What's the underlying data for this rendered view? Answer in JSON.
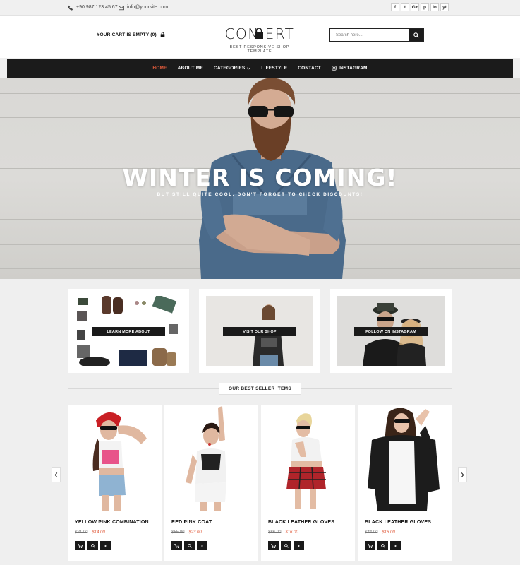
{
  "topbar": {
    "phone": "+90 987 123 45 67",
    "email": "info@yoursite.com",
    "social": [
      "f",
      "t",
      "G+",
      "p",
      "in",
      "yt"
    ]
  },
  "header": {
    "cart": "YOUR CART IS EMPTY (0)",
    "logo_word": "CONCEPT",
    "logo_tagline": "BEST RESPONSIVE SHOP TEMPLATE",
    "search_placeholder": "Search here..."
  },
  "nav": {
    "items": [
      "HOME",
      "ABOUT ME",
      "CATEGORIES",
      "LIFESTYLE",
      "CONTACT",
      "INSTAGRAM"
    ],
    "active": "HOME"
  },
  "hero": {
    "title": "WINTER IS COMING!",
    "subtitle": "BUT STILL QUITE COOL. DON'T FORGET TO CHECK DISCOUNTS!"
  },
  "promos": [
    "LEARN MORE ABOUT",
    "VISIT OUR SHOP",
    "FOLLOW ON INSTAGRAM"
  ],
  "section_title": "OUR BEST SELLER ITEMS",
  "products": [
    {
      "name": "YELLOW PINK COMBINATION",
      "old_price": "$21.00",
      "new_price": "$14.00"
    },
    {
      "name": "RED PINK COAT",
      "old_price": "$55.00",
      "new_price": "$23.00"
    },
    {
      "name": "BLACK LEATHER GLOVES",
      "old_price": "$66.00",
      "new_price": "$16.00"
    },
    {
      "name": "BLACK LEATHER GLOVES",
      "old_price": "$44.00",
      "new_price": "$16.00"
    }
  ],
  "icons": [
    "phone-icon",
    "mail-icon",
    "bag-icon",
    "search-icon",
    "chevron-down-icon",
    "instagram-icon",
    "cart-icon",
    "zoom-icon",
    "shuffle-icon",
    "arrow-left-icon",
    "arrow-right-icon"
  ],
  "colors": {
    "accent": "#e05a3a",
    "nav_bg": "#1b1b1b",
    "page_bg": "#efefef"
  }
}
